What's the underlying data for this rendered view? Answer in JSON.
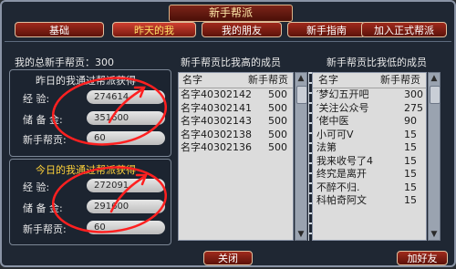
{
  "window": {
    "title": "新手帮派"
  },
  "tabs": [
    {
      "label": "基础"
    },
    {
      "label": "昨天的我"
    },
    {
      "label": "我的朋友"
    },
    {
      "label": "新手指南"
    },
    {
      "label": "加入正式帮派"
    }
  ],
  "summary": {
    "label": "我的总新手帮贡：300"
  },
  "yesterday": {
    "heading": "昨日的我通过帮派获得",
    "exp_label": "经    验:",
    "exp_value": "274614",
    "reserve_label": "储 备 金:",
    "reserve_value": "351600",
    "contrib_label": "新手帮贡:",
    "contrib_value": "60"
  },
  "today": {
    "heading": "今日的我通过帮派获得",
    "exp_label": "经    验:",
    "exp_value": "272091",
    "reserve_label": "储 备 金:",
    "reserve_value": "291600",
    "contrib_label": "新手帮贡:",
    "contrib_value": "60"
  },
  "higher_list": {
    "title": "新手帮贡比我高的成员",
    "col_name": "名字",
    "col_contrib": "新手帮贡",
    "rows": [
      {
        "name": "名字40302142",
        "contrib": "500"
      },
      {
        "name": "名字40302141",
        "contrib": "500"
      },
      {
        "name": "名字40302143",
        "contrib": "500"
      },
      {
        "name": "名字40302138",
        "contrib": "500"
      },
      {
        "name": "名字40302136",
        "contrib": "500"
      }
    ]
  },
  "lower_list": {
    "title": "新手帮贡比我低的成员",
    "col_name": "名字",
    "col_contrib": "新手帮贡",
    "rows": [
      {
        "name": "′梦幻五开吧",
        "contrib": "300"
      },
      {
        "name": "′关注公众号",
        "contrib": "275"
      },
      {
        "name": "′佬中医",
        "contrib": "90"
      },
      {
        "name": "小可可V",
        "contrib": "15"
      },
      {
        "name": "法第",
        "contrib": "15"
      },
      {
        "name": "我来收号了4",
        "contrib": "15"
      },
      {
        "name": "终究是离开",
        "contrib": "15"
      },
      {
        "name": "不醉不归.",
        "contrib": "15"
      },
      {
        "name": "科帕奇阿文",
        "contrib": "15"
      }
    ]
  },
  "buttons": {
    "close": "关闭",
    "add_friend": "加好友"
  },
  "colors": {
    "accent_red": "#a02a1c",
    "heading_yellow": "#ffd23a",
    "annotation_red": "#ff2020"
  }
}
